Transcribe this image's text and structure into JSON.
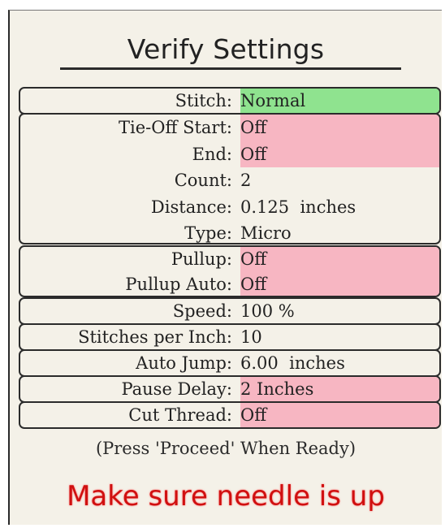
{
  "dialog": {
    "title": "Verify Settings",
    "notice": "(Press 'Proceed' When Ready)",
    "warning": "Make sure needle is up"
  },
  "settings": {
    "stitch": {
      "label": "Stitch:",
      "value": "Normal"
    },
    "tieoff_start": {
      "label": "Tie-Off Start:",
      "value": "Off"
    },
    "tieoff_end": {
      "label": "End:",
      "value": "Off"
    },
    "tieoff_count": {
      "label": "Count:",
      "value": "2"
    },
    "tieoff_distance": {
      "label": "Distance:",
      "value": "0.125  inches"
    },
    "tieoff_type": {
      "label": "Type:",
      "value": "Micro"
    },
    "pullup": {
      "label": "Pullup:",
      "value": "Off"
    },
    "pullup_auto": {
      "label": "Pullup Auto:",
      "value": "Off"
    },
    "speed": {
      "label": "Speed:",
      "value": "100 %"
    },
    "stitches_per_inch": {
      "label": "Stitches per Inch:",
      "value": "10"
    },
    "auto_jump": {
      "label": "Auto Jump:",
      "value": "6.00  inches"
    },
    "pause_delay": {
      "label": "Pause Delay:",
      "value": "2 Inches"
    },
    "cut_thread": {
      "label": "Cut Thread:",
      "value": "Off"
    }
  },
  "colors": {
    "enabled": "#8fe38f",
    "disabled": "#f7b6c2",
    "warning": "#d01010"
  }
}
